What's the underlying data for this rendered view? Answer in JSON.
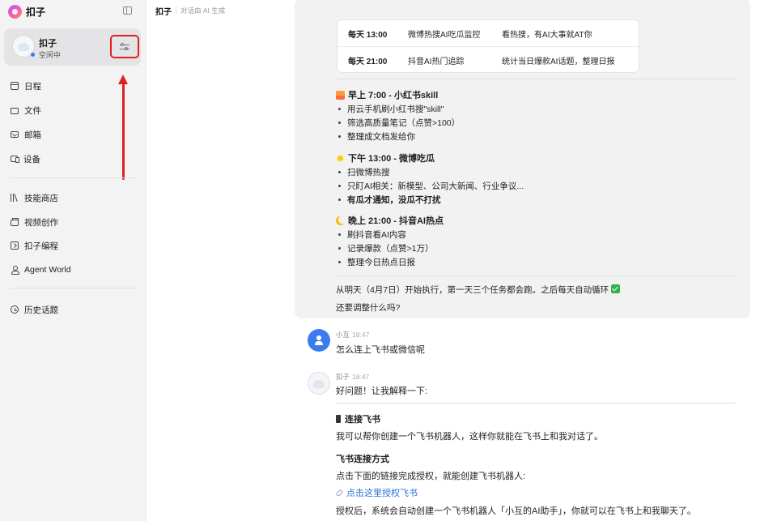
{
  "brand": {
    "name": "扣子"
  },
  "agent": {
    "name": "扣子",
    "status": "空闲中"
  },
  "nav": {
    "primary": [
      {
        "label": "日程",
        "icon": "calendar-icon"
      },
      {
        "label": "文件",
        "icon": "folder-icon"
      },
      {
        "label": "邮箱",
        "icon": "mail-icon"
      },
      {
        "label": "设备",
        "icon": "device-icon"
      }
    ],
    "secondary": [
      {
        "label": "技能商店",
        "icon": "skill-store-icon"
      },
      {
        "label": "视频创作",
        "icon": "video-icon"
      },
      {
        "label": "扣子编程",
        "icon": "code-icon"
      },
      {
        "label": "Agent World",
        "icon": "agent-world-icon"
      }
    ],
    "history": {
      "label": "历史话题",
      "icon": "history-icon"
    }
  },
  "header": {
    "title": "扣子",
    "subtitle": "对话由 AI 生成"
  },
  "schedule_table": [
    {
      "time": "每天 13:00",
      "task": "微博热搜AI吃瓜监控",
      "desc": "看热搜，有AI大事就AT你"
    },
    {
      "time": "每天 21:00",
      "task": "抖音AI热门追踪",
      "desc": "统计当日爆款AI话题，整理日报"
    }
  ],
  "sections": [
    {
      "title": "早上 7:00 - 小红书skill",
      "icon": "sunrise-icon",
      "bullets": [
        "用云手机刷小红书搜\"skill\"",
        "筛选高质量笔记（点赞>100）",
        "整理成文档发给你"
      ]
    },
    {
      "title": "下午 13:00 - 微博吃瓜",
      "icon": "sun-icon",
      "bullets": [
        "扫微博热搜",
        "只盯AI相关：新模型、公司大新闻、行业争议...",
        "有瓜才通知，没瓜不打扰"
      ]
    },
    {
      "title": "晚上 21:00 - 抖音AI热点",
      "icon": "moon-icon",
      "bullets": [
        "刷抖音看AI内容",
        "记录爆款（点赞>1万）",
        "整理今日热点日报"
      ]
    }
  ],
  "bubble_footer": {
    "line1": "从明天（4月7日）开始执行，第一天三个任务都会跑。之后每天自动循环",
    "line2": "还要调整什么吗?"
  },
  "messages": {
    "user": {
      "name": "小互",
      "time": "18:47",
      "text": "怎么连上飞书或微信呢"
    },
    "bot": {
      "name": "扣子",
      "time": "18:47",
      "intro": "好问题！让我解释一下:",
      "heading": "连接飞书",
      "p1": "我可以帮你创建一个飞书机器人，这样你就能在飞书上和我对话了。",
      "subheading": "飞书连接方式",
      "p2": "点击下面的链接完成授权，就能创建飞书机器人:",
      "link": "点击这里授权飞书",
      "p3": "授权后，系统会自动创建一个飞书机器人「小互的AI助手」，你就可以在飞书上和我聊天了。"
    }
  },
  "colors": {
    "accent": "#2a6fdb",
    "annotation": "#e02020",
    "user_avatar": "#3a7cf0"
  }
}
